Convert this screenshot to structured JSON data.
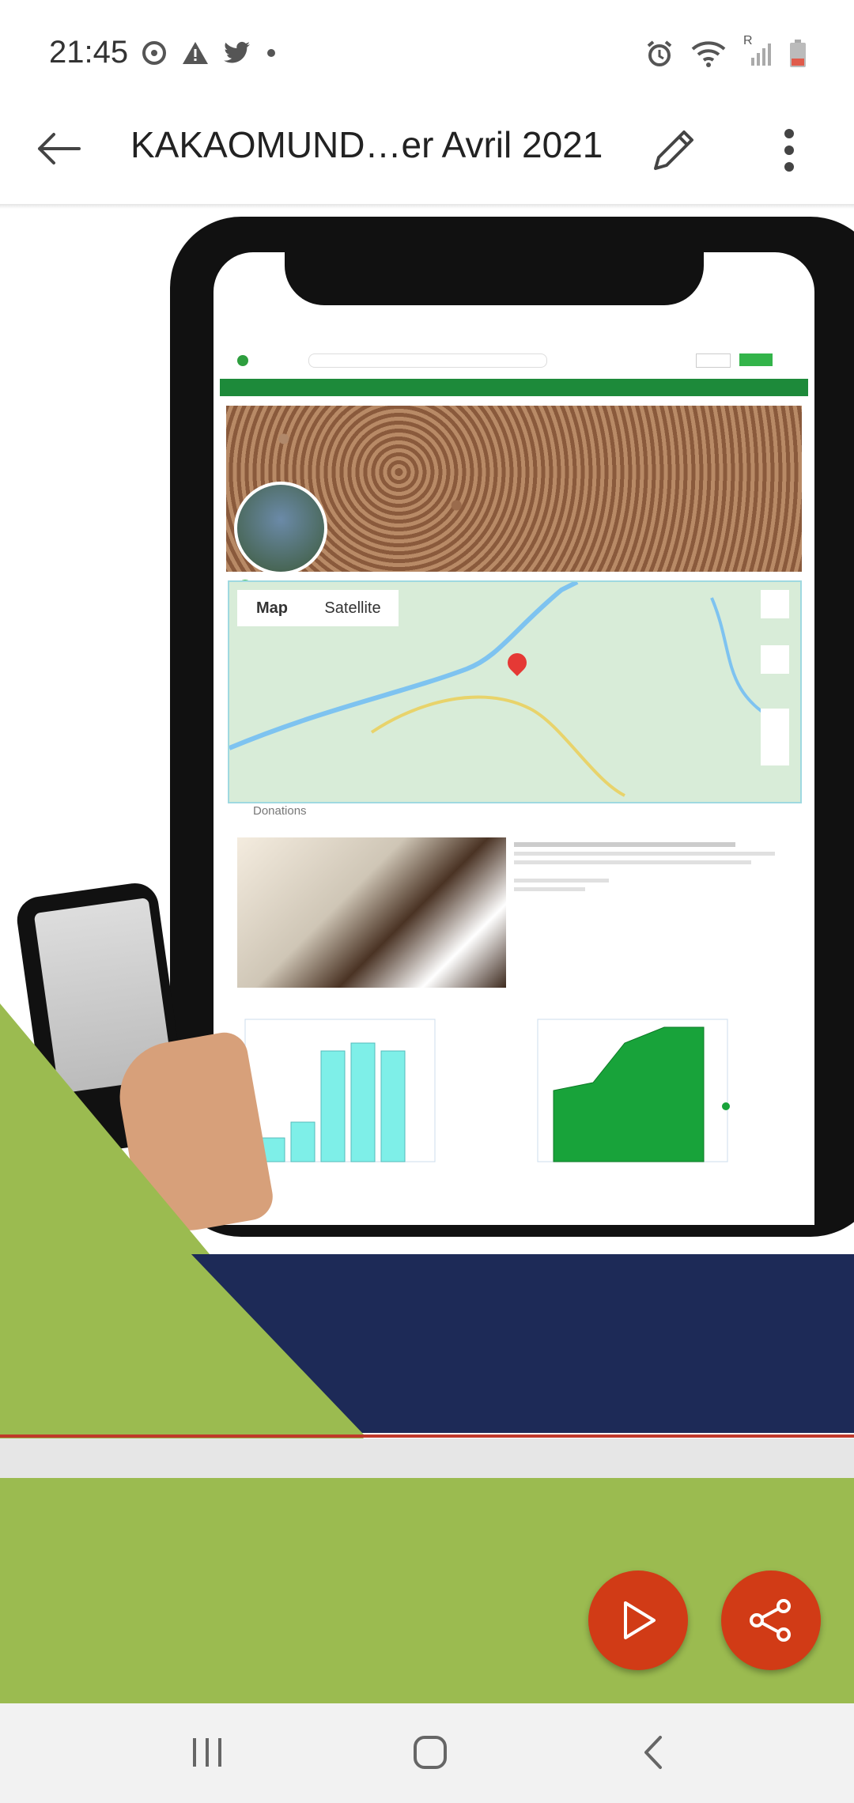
{
  "status_bar": {
    "time": "21:45",
    "left_icons": [
      "sync-icon",
      "warning-icon",
      "twitter-icon",
      "dot-icon"
    ],
    "right_icons": [
      "alarm-icon",
      "wifi-icon",
      "signal-icon",
      "battery-icon"
    ],
    "roaming": "R"
  },
  "app_bar": {
    "title": "KAKAOMUND…er Avril 2021"
  },
  "slide": {
    "map_tabs": [
      "Map",
      "Satellite"
    ],
    "section_title": "Donations",
    "colors": {
      "green": "#9bbb50",
      "navy": "#1d2a57",
      "accent_red": "#c0392b"
    }
  },
  "fabs": {
    "play": "play-icon",
    "share": "share-icon",
    "color": "#d13b16"
  },
  "nav_bar": {
    "buttons": [
      "recents-icon",
      "home-icon",
      "back-icon"
    ]
  }
}
